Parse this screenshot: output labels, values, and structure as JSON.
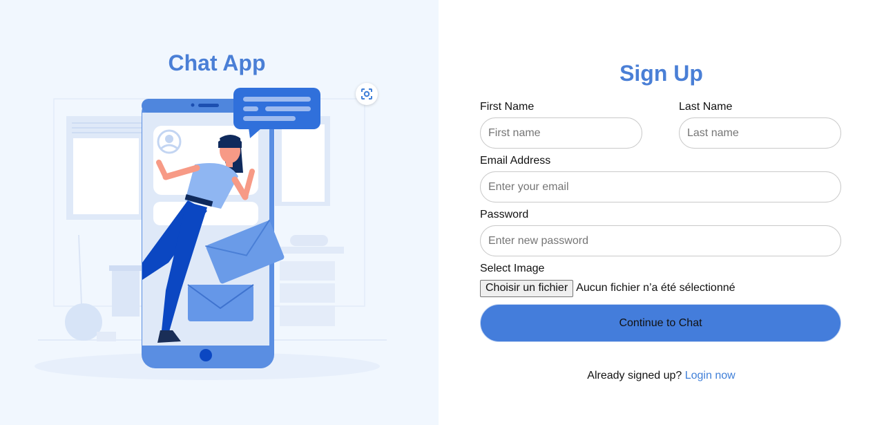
{
  "left": {
    "title": "Chat App",
    "illustration_icon": "person-with-phone-chat-illustration",
    "lens_icon": "scan-lens-icon"
  },
  "signup": {
    "title": "Sign Up",
    "first_name": {
      "label": "First Name",
      "placeholder": "First name",
      "value": ""
    },
    "last_name": {
      "label": "Last Name",
      "placeholder": "Last name",
      "value": ""
    },
    "email": {
      "label": "Email Address",
      "placeholder": "Enter your email",
      "value": ""
    },
    "password": {
      "label": "Password",
      "placeholder": "Enter new password",
      "value": ""
    },
    "image": {
      "label": "Select Image",
      "button_label": "Choisir un fichier",
      "status": "Aucun fichier n’a été sélectionné"
    },
    "submit_label": "Continue to Chat",
    "footer_text": "Already signed up?",
    "footer_link": "Login now"
  },
  "colors": {
    "accent": "#447ddb",
    "title": "#4a7fd6",
    "link": "#3f7fd8",
    "left_bg": "#f1f7fe"
  }
}
